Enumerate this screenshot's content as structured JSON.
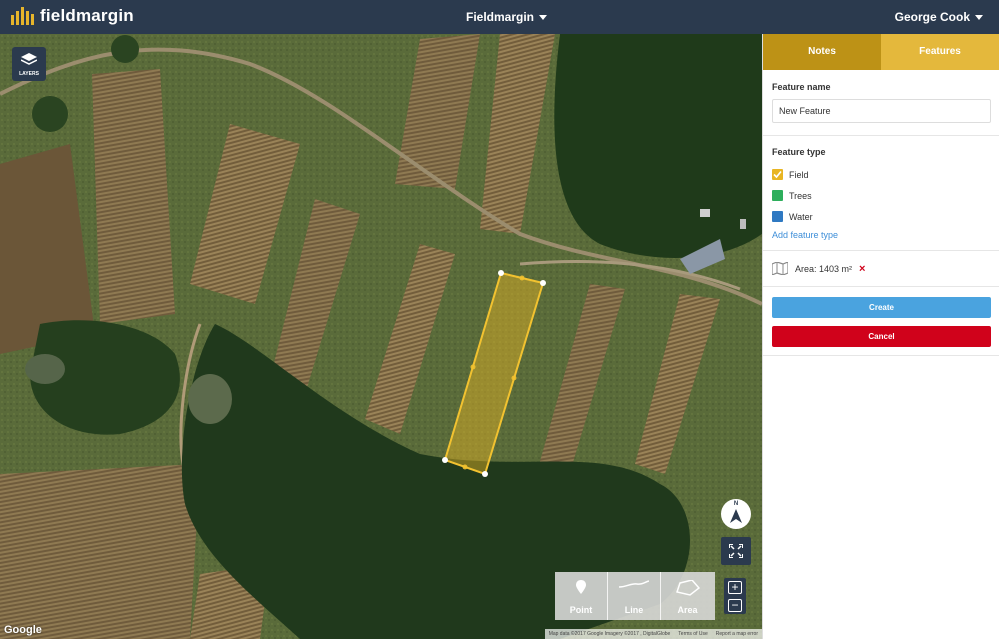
{
  "header": {
    "logo_text": "fieldmargin",
    "farm_name": "Fieldmargin",
    "user_name": "George Cook"
  },
  "map": {
    "layers_label": "LAYERS",
    "compass_label": "N",
    "zoom_in": "+",
    "zoom_out": "−",
    "tools": [
      {
        "label": "Point",
        "icon": "point-icon"
      },
      {
        "label": "Line",
        "icon": "line-icon"
      },
      {
        "label": "Area",
        "icon": "area-icon"
      }
    ],
    "google_label": "Google",
    "attribution": [
      "Map data ©2017 Google Imagery ©2017 , DigitalGlobe",
      "Terms of Use",
      "Report a map error"
    ]
  },
  "panel": {
    "tabs": [
      {
        "label": "Notes",
        "active": false
      },
      {
        "label": "Features",
        "active": true
      }
    ],
    "feature_name_label": "Feature name",
    "feature_name_value": "New Feature",
    "feature_type_label": "Feature type",
    "feature_types": [
      {
        "label": "Field",
        "color": "#e8b523",
        "checked": true
      },
      {
        "label": "Trees",
        "color": "#2eae5c",
        "checked": false
      },
      {
        "label": "Water",
        "color": "#2f79c2",
        "checked": false
      }
    ],
    "add_feature_type": "Add feature type",
    "area_text": "Area: 1403 m²",
    "area_remove": "×",
    "create_label": "Create",
    "cancel_label": "Cancel"
  },
  "colors": {
    "header_bg": "#2b3a4e",
    "accent": "#e4b83c",
    "create": "#4aa3df",
    "cancel": "#d0021b"
  }
}
